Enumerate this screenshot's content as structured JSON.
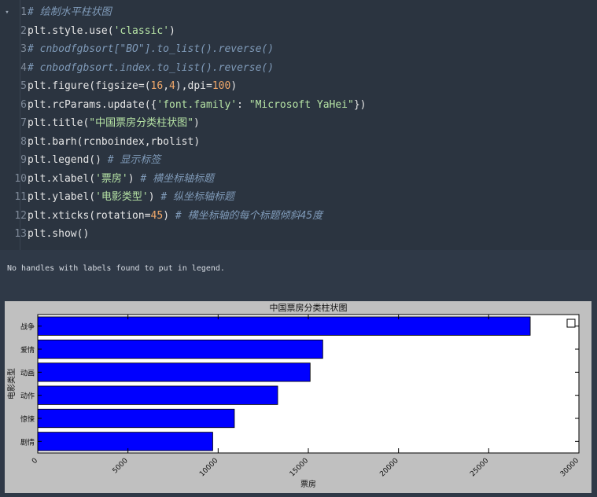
{
  "editor": {
    "collapse_glyph": "▾",
    "lines": [
      {
        "n": "1",
        "parts": [
          {
            "t": "# 绘制水平柱状图",
            "c": "comment"
          }
        ]
      },
      {
        "n": "2",
        "parts": [
          {
            "t": "plt.style.use(",
            "c": ""
          },
          {
            "t": "'classic'",
            "c": "str"
          },
          {
            "t": ")",
            "c": ""
          }
        ]
      },
      {
        "n": "3",
        "parts": [
          {
            "t": "# cnbodfgbsort[\"BO\"].to_list().reverse()",
            "c": "comment"
          }
        ]
      },
      {
        "n": "4",
        "parts": [
          {
            "t": "# cnbodfgbsort.index.to_list().reverse()",
            "c": "comment"
          }
        ]
      },
      {
        "n": "5",
        "parts": [
          {
            "t": "plt.figure(figsize=(",
            "c": ""
          },
          {
            "t": "16",
            "c": "num"
          },
          {
            "t": ",",
            "c": ""
          },
          {
            "t": "4",
            "c": "num"
          },
          {
            "t": "),dpi=",
            "c": ""
          },
          {
            "t": "100",
            "c": "num"
          },
          {
            "t": ")",
            "c": ""
          }
        ]
      },
      {
        "n": "6",
        "parts": [
          {
            "t": "plt.rcParams.update({",
            "c": ""
          },
          {
            "t": "'font.family'",
            "c": "str"
          },
          {
            "t": ": ",
            "c": ""
          },
          {
            "t": "\"Microsoft YaHei\"",
            "c": "str"
          },
          {
            "t": "})",
            "c": ""
          }
        ]
      },
      {
        "n": "7",
        "parts": [
          {
            "t": "plt.title(",
            "c": ""
          },
          {
            "t": "\"中国票房分类柱状图\"",
            "c": "str"
          },
          {
            "t": ")",
            "c": ""
          }
        ]
      },
      {
        "n": "8",
        "parts": [
          {
            "t": "plt.barh(rcnboindex,rbolist)",
            "c": ""
          }
        ]
      },
      {
        "n": "9",
        "parts": [
          {
            "t": "plt.legend() ",
            "c": ""
          },
          {
            "t": "# 显示标签",
            "c": "comment"
          }
        ]
      },
      {
        "n": "10",
        "parts": [
          {
            "t": "plt.xlabel(",
            "c": ""
          },
          {
            "t": "'票房'",
            "c": "str"
          },
          {
            "t": ") ",
            "c": ""
          },
          {
            "t": "# 横坐标轴标题",
            "c": "comment"
          }
        ]
      },
      {
        "n": "11",
        "parts": [
          {
            "t": "plt.ylabel(",
            "c": ""
          },
          {
            "t": "'电影类型'",
            "c": "str"
          },
          {
            "t": ") ",
            "c": ""
          },
          {
            "t": "# 纵坐标轴标题",
            "c": "comment"
          }
        ]
      },
      {
        "n": "12",
        "parts": [
          {
            "t": "plt.xticks(rotation=",
            "c": ""
          },
          {
            "t": "45",
            "c": "num"
          },
          {
            "t": ") ",
            "c": ""
          },
          {
            "t": "# 横坐标轴的每个标题倾斜45度",
            "c": "comment"
          }
        ]
      },
      {
        "n": "13",
        "parts": [
          {
            "t": "plt.show()",
            "c": ""
          }
        ]
      }
    ]
  },
  "output": {
    "stderr_text": "No handles with labels found to put in legend."
  },
  "chart_data": {
    "type": "bar",
    "orientation": "horizontal",
    "title": "中国票房分类柱状图",
    "xlabel": "票房",
    "ylabel": "电影类型",
    "categories": [
      "剧情",
      "惊悚",
      "动作",
      "动画",
      "爱情",
      "战争"
    ],
    "values": [
      9700,
      10900,
      13300,
      15100,
      15800,
      27300
    ],
    "xlim": [
      0,
      30000
    ],
    "xticks": [
      0,
      5000,
      10000,
      15000,
      20000,
      25000,
      30000
    ],
    "xtick_rotation": 45,
    "bar_color": "#0000ff",
    "legend": "empty box, top-right",
    "grid": false
  }
}
